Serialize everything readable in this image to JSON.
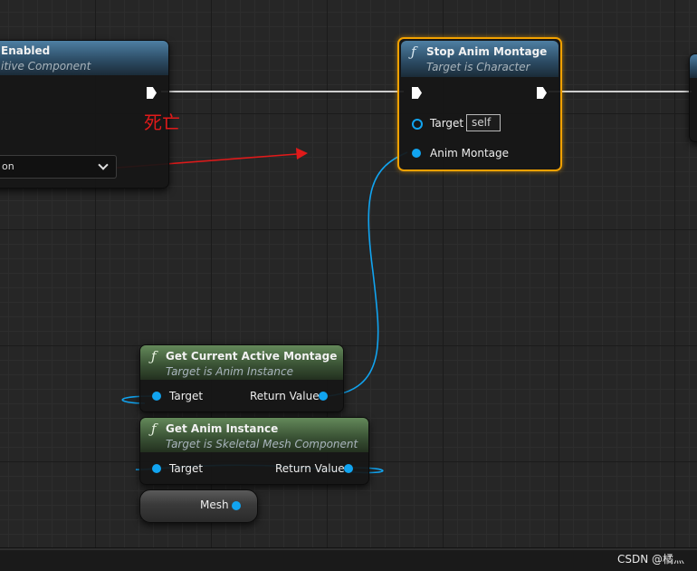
{
  "nodes": {
    "set_collision": {
      "title": "Enabled",
      "subtitle": "itive Component",
      "dropdown_value": "on"
    },
    "stop_anim_montage": {
      "title": "Stop Anim Montage",
      "subtitle": "Target is Character",
      "target_label": "Target",
      "target_default": "self",
      "montage_label": "Anim Montage"
    },
    "get_current_active_montage": {
      "title": "Get Current Active Montage",
      "subtitle": "Target is Anim Instance",
      "target_label": "Target",
      "return_label": "Return Value"
    },
    "get_anim_instance": {
      "title": "Get Anim Instance",
      "subtitle": "Target is Skeletal Mesh Component",
      "target_label": "Target",
      "return_label": "Return Value"
    },
    "mesh_variable": {
      "label": "Mesh"
    }
  },
  "annotation": {
    "text": "死亡",
    "color": "#e01a1a"
  },
  "colors": {
    "object_pin": "#11a4f0",
    "selection": "#f2a100",
    "function_header_blue": "#2d4d66",
    "pure_header_green": "#3b5436"
  },
  "icons": {
    "function": "function-f-icon",
    "exec": "exec-pin-icon"
  },
  "watermark": "CSDN @橘灬"
}
